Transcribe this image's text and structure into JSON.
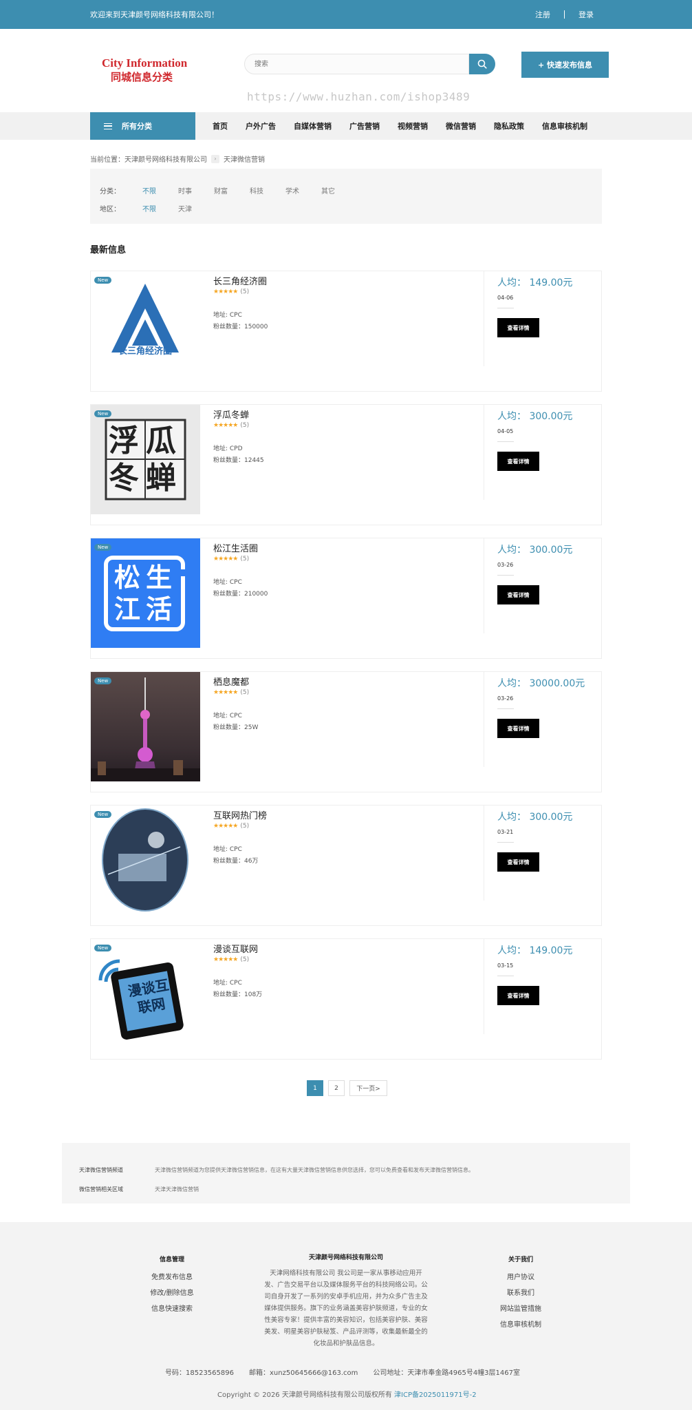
{
  "topbar": {
    "welcome": "欢迎来到天津颜号网络科技有限公司！",
    "register": "注册",
    "login": "登录"
  },
  "header": {
    "logo_en": "City Information",
    "logo_cn": "同城信息分类",
    "search_placeholder": "搜索",
    "publish_button": "+ 快速发布信息",
    "watermark": "https://www.huzhan.com/ishop3489"
  },
  "nav": {
    "categories_label": "所有分类",
    "items": [
      "首页",
      "户外广告",
      "自媒体营销",
      "广告营销",
      "视频营销",
      "微信营销",
      "隐私政策",
      "信息审核机制"
    ]
  },
  "breadcrumb": {
    "prefix": "当前位置：",
    "home": "天津颜号网络科技有限公司",
    "current": "天津微信营销"
  },
  "filters": {
    "category_label": "分类：",
    "category_options": [
      "不限",
      "时事",
      "财富",
      "科技",
      "学术",
      "其它"
    ],
    "region_label": "地区：",
    "region_options": [
      "不限",
      "天津"
    ]
  },
  "section_title": "最新信息",
  "listings": [
    {
      "badge": "New",
      "title": "长三角经济圈",
      "stars": "★★★★★",
      "rating": "(5)",
      "addr": "地址: CPC",
      "fans": "粉丝数量：150000",
      "price": "人均： 149.00元",
      "date": "04-06",
      "button": "查看详情",
      "image_text": "长三角经济圈"
    },
    {
      "badge": "New",
      "title": "浮瓜冬蝉",
      "stars": "★★★★★",
      "rating": "(5)",
      "addr": "地址: CPD",
      "fans": "粉丝数量：12445",
      "price": "人均： 300.00元",
      "date": "04-05",
      "button": "查看详情",
      "image_text": "浮瓜冬蝉"
    },
    {
      "badge": "New",
      "title": "松江生活圈",
      "stars": "★★★★★",
      "rating": "(5)",
      "addr": "地址: CPC",
      "fans": "粉丝数量：210000",
      "price": "人均： 300.00元",
      "date": "03-26",
      "button": "查看详情",
      "image_text": "松生江活"
    },
    {
      "badge": "New",
      "title": "栖息魔都",
      "stars": "★★★★★",
      "rating": "(5)",
      "addr": "地址: CPC",
      "fans": "粉丝数量：25W",
      "price": "人均： 30000.00元",
      "date": "03-26",
      "button": "查看详情"
    },
    {
      "badge": "New",
      "title": "互联网热门榜",
      "stars": "★★★★★",
      "rating": "(5)",
      "addr": "地址: CPC",
      "fans": "粉丝数量：46万",
      "price": "人均： 300.00元",
      "date": "03-21",
      "button": "查看详情"
    },
    {
      "badge": "New",
      "title": "漫谈互联网",
      "stars": "★★★★★",
      "rating": "(5)",
      "addr": "地址: CPC",
      "fans": "粉丝数量：108万",
      "price": "人均： 149.00元",
      "date": "03-15",
      "button": "查看详情",
      "image_text": "漫谈互联网"
    }
  ],
  "pager": {
    "pages": [
      "1",
      "2"
    ],
    "next": "下一页>"
  },
  "related": {
    "k1": "天津微信营销频道",
    "v1": "天津微信营销频道为您提供天津微信营销信息，在这有大量天津微信营销信息供您选择，您可以免费查看和发布天津微信营销信息。",
    "k2": "微信营销相关区域",
    "v2": "天津天津微信营销"
  },
  "footer": {
    "col1_title": "信息管理",
    "col1_items": [
      "免费发布信息",
      "修改/删除信息",
      "信息快速搜索"
    ],
    "about_title": "天津颜号网络科技有限公司",
    "about_text": "天津网络科技有限公司 我公司是一家从事移动应用开发、广告交易平台以及媒体服务平台的科技网络公司。公司自身开发了一系列的安卓手机应用，并为众多广告主及媒体提供服务。旗下的业务涵盖美容护肤频道，专业的女性美容专家！提供丰富的美容知识，包括美容护肤、美容美发、明星美容护肤秘笈、产品评测等，收集最新最全的化妆品和护肤品信息。",
    "col3_title": "关于我们",
    "col3_items": [
      "用户协议",
      "联系我们",
      "网站监管措施",
      "信息审核机制"
    ],
    "phone": "号码：18523565896",
    "email": "邮箱：xunz50645666@163.com",
    "address": "公司地址：天津市奉金路4965号4幢3层1467室",
    "copyright": "Copyright © 2026 天津颜号网络科技有限公司版权所有",
    "icp": "津ICP备2025011971号-2"
  }
}
